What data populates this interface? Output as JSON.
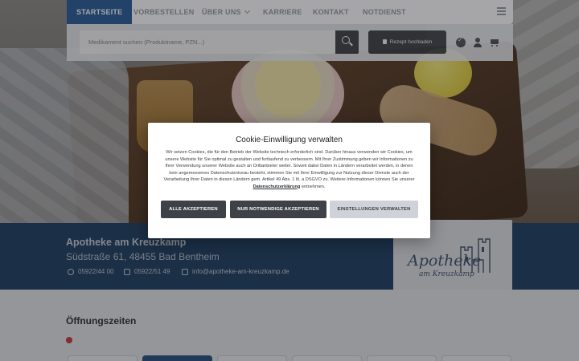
{
  "nav": {
    "items": [
      {
        "label": "STARTSEITE",
        "active": true
      },
      {
        "label": "VORBESTELLEN",
        "active": false
      },
      {
        "label": "ÜBER UNS",
        "active": false,
        "has_dropdown": true
      },
      {
        "label": "KARRIERE",
        "active": false
      },
      {
        "label": "KONTAKT",
        "active": false
      },
      {
        "label": "NOTDIENST",
        "active": false
      }
    ],
    "menu_icon": "hamburger-icon"
  },
  "search": {
    "placeholder": "Medikament suchen (Produktname, PZN...)",
    "button_icon": "search-icon"
  },
  "rezept_button": {
    "label": "Rezept hochladen",
    "icon": "document-icon"
  },
  "header_icons": [
    "check-circle-icon",
    "user-icon",
    "cart-icon"
  ],
  "pharmacy": {
    "name": "Apotheke am Kreuzkamp",
    "address": "Südstraße 61, 48455 Bad Bentheim",
    "phone": "05922/44 00",
    "fax": "05922/51 49",
    "email": "info@apotheke-am-kreuzkamp.de",
    "logo_line1": "Apotheke",
    "logo_line2": "am Kreuzkamp"
  },
  "hours": {
    "title": "Öffnungszeiten",
    "status_color": "#c73b3b",
    "day_tabs": 6,
    "active_tab": 1
  },
  "cookie": {
    "title": "Cookie-Einwilligung verwalten",
    "text_before_link": "Wir setzen Cookies, die für den Betrieb der Website technisch erforderlich sind. Darüber hinaus verwenden wir Cookies, um unsere Website für Sie optimal zu gestalten und fortlaufend zu verbessern. Mit Ihrer Zustimmung geben wir Informationen zu Ihrer Verwendung unserer Website auch an Drittanbieter weiter. Soweit dabei Daten in Ländern verarbeitet werden, in denen kein angemessenes Datenschutzniveau besteht, stimmen Sie mit Ihrer Einwilligung zur Nutzung dieser Dienste auch der Verarbeitung Ihrer Daten in diesen Ländern gem. Artikel 49 Abs. 1 lit. a DSGVO zu. Weitere Informationen können Sie unserer",
    "link_text": "Datenschutzerklärung",
    "text_after_link": "entnehmen.",
    "buttons": {
      "accept_all": "ALLE AKZEPTIEREN",
      "necessary_only": "NUR NOTWENDIGE AKZEPTIEREN",
      "settings": "EINSTELLUNGEN VERWALTEN"
    }
  },
  "colors": {
    "primary": "#27527f",
    "nav_active": "#2a5e99",
    "button_dark": "#3e4148"
  }
}
